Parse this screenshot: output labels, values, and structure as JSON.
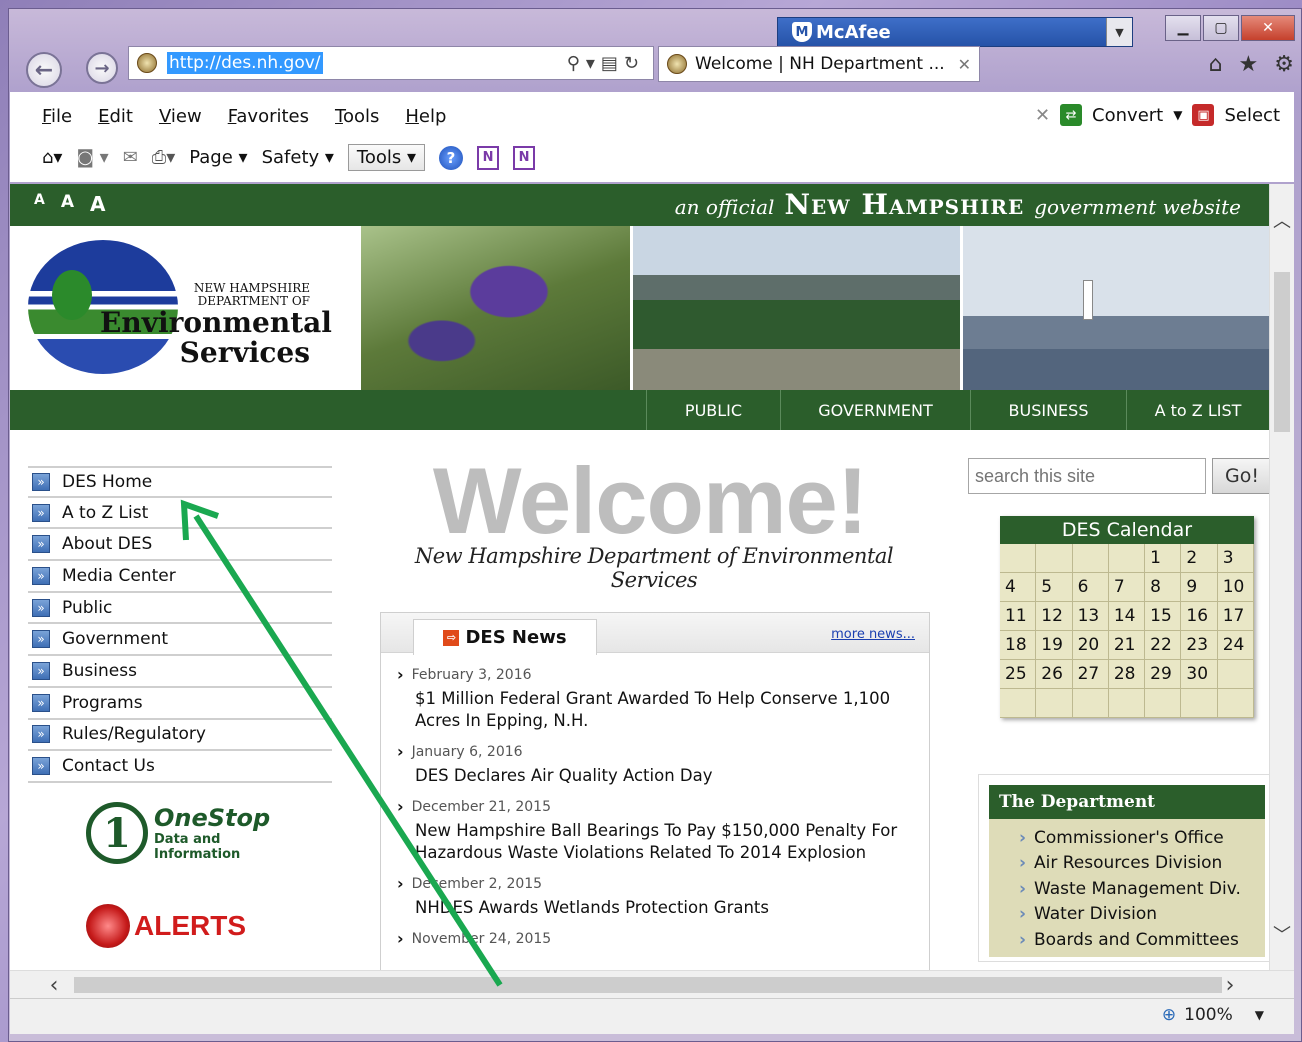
{
  "browser": {
    "mcafee_label": "McAfee",
    "address_url": "http://des.nh.gov/",
    "tab_title": "Welcome | NH Department ...",
    "menu": [
      "File",
      "Edit",
      "View",
      "Favorites",
      "Tools",
      "Help"
    ],
    "convert_label": "Convert",
    "select_label": "Select",
    "command": {
      "page": "Page",
      "safety": "Safety",
      "tools": "Tools"
    },
    "zoom": "100%"
  },
  "site": {
    "text_sizes": [
      "A",
      "A",
      "A"
    ],
    "official_prefix": "an official",
    "official_state": "New Hampshire",
    "official_suffix": "government website",
    "logo": {
      "line1": "NEW HAMPSHIRE",
      "line2": "DEPARTMENT OF",
      "line3": "Environmental",
      "line4": "Services"
    },
    "topnav": [
      "PUBLIC",
      "GOVERNMENT",
      "BUSINESS",
      "A to Z LIST"
    ],
    "leftnav": [
      "DES Home",
      "A to Z List",
      "About DES",
      "Media Center",
      "Public",
      "Government",
      "Business",
      "Programs",
      "Rules/Regulatory",
      "Contact Us"
    ],
    "onestop": {
      "title": "OneStop",
      "line1": "Data and",
      "line2": "Information"
    },
    "alerts": "ALERTS",
    "welcome": "Welcome!",
    "tagline": "New Hampshire Department of Environmental Services",
    "news": {
      "heading": "DES News",
      "more": "more news...",
      "items": [
        {
          "date": "February 3, 2016",
          "title": "$1 Million Federal Grant Awarded To Help Conserve 1,100 Acres In Epping, N.H."
        },
        {
          "date": "January 6, 2016",
          "title": "DES Declares Air Quality Action Day"
        },
        {
          "date": "December 21, 2015",
          "title": "New Hampshire Ball Bearings To Pay $150,000 Penalty For Hazardous Waste Violations Related To 2014 Explosion"
        },
        {
          "date": "December 2, 2015",
          "title": "NHDES Awards Wetlands Protection Grants"
        },
        {
          "date": "November 24, 2015",
          "title": ""
        }
      ]
    },
    "search": {
      "placeholder": "search this site",
      "go": "Go!"
    },
    "calendar": {
      "title": "DES Calendar",
      "cells": [
        "",
        "",
        "",
        "",
        "1",
        "2",
        "3",
        "4",
        "5",
        "6",
        "7",
        "8",
        "9",
        "10",
        "11",
        "12",
        "13",
        "14",
        "15",
        "16",
        "17",
        "18",
        "19",
        "20",
        "21",
        "22",
        "23",
        "24",
        "25",
        "26",
        "27",
        "28",
        "29",
        "30",
        "",
        "",
        "",
        "",
        "",
        "",
        "",
        ""
      ]
    },
    "department": {
      "title": "The Department",
      "items": [
        "Commissioner's Office",
        "Air Resources Division",
        "Waste Management Div.",
        "Water Division",
        "Boards and Committees"
      ]
    }
  },
  "annotation_color": "#1aa850"
}
